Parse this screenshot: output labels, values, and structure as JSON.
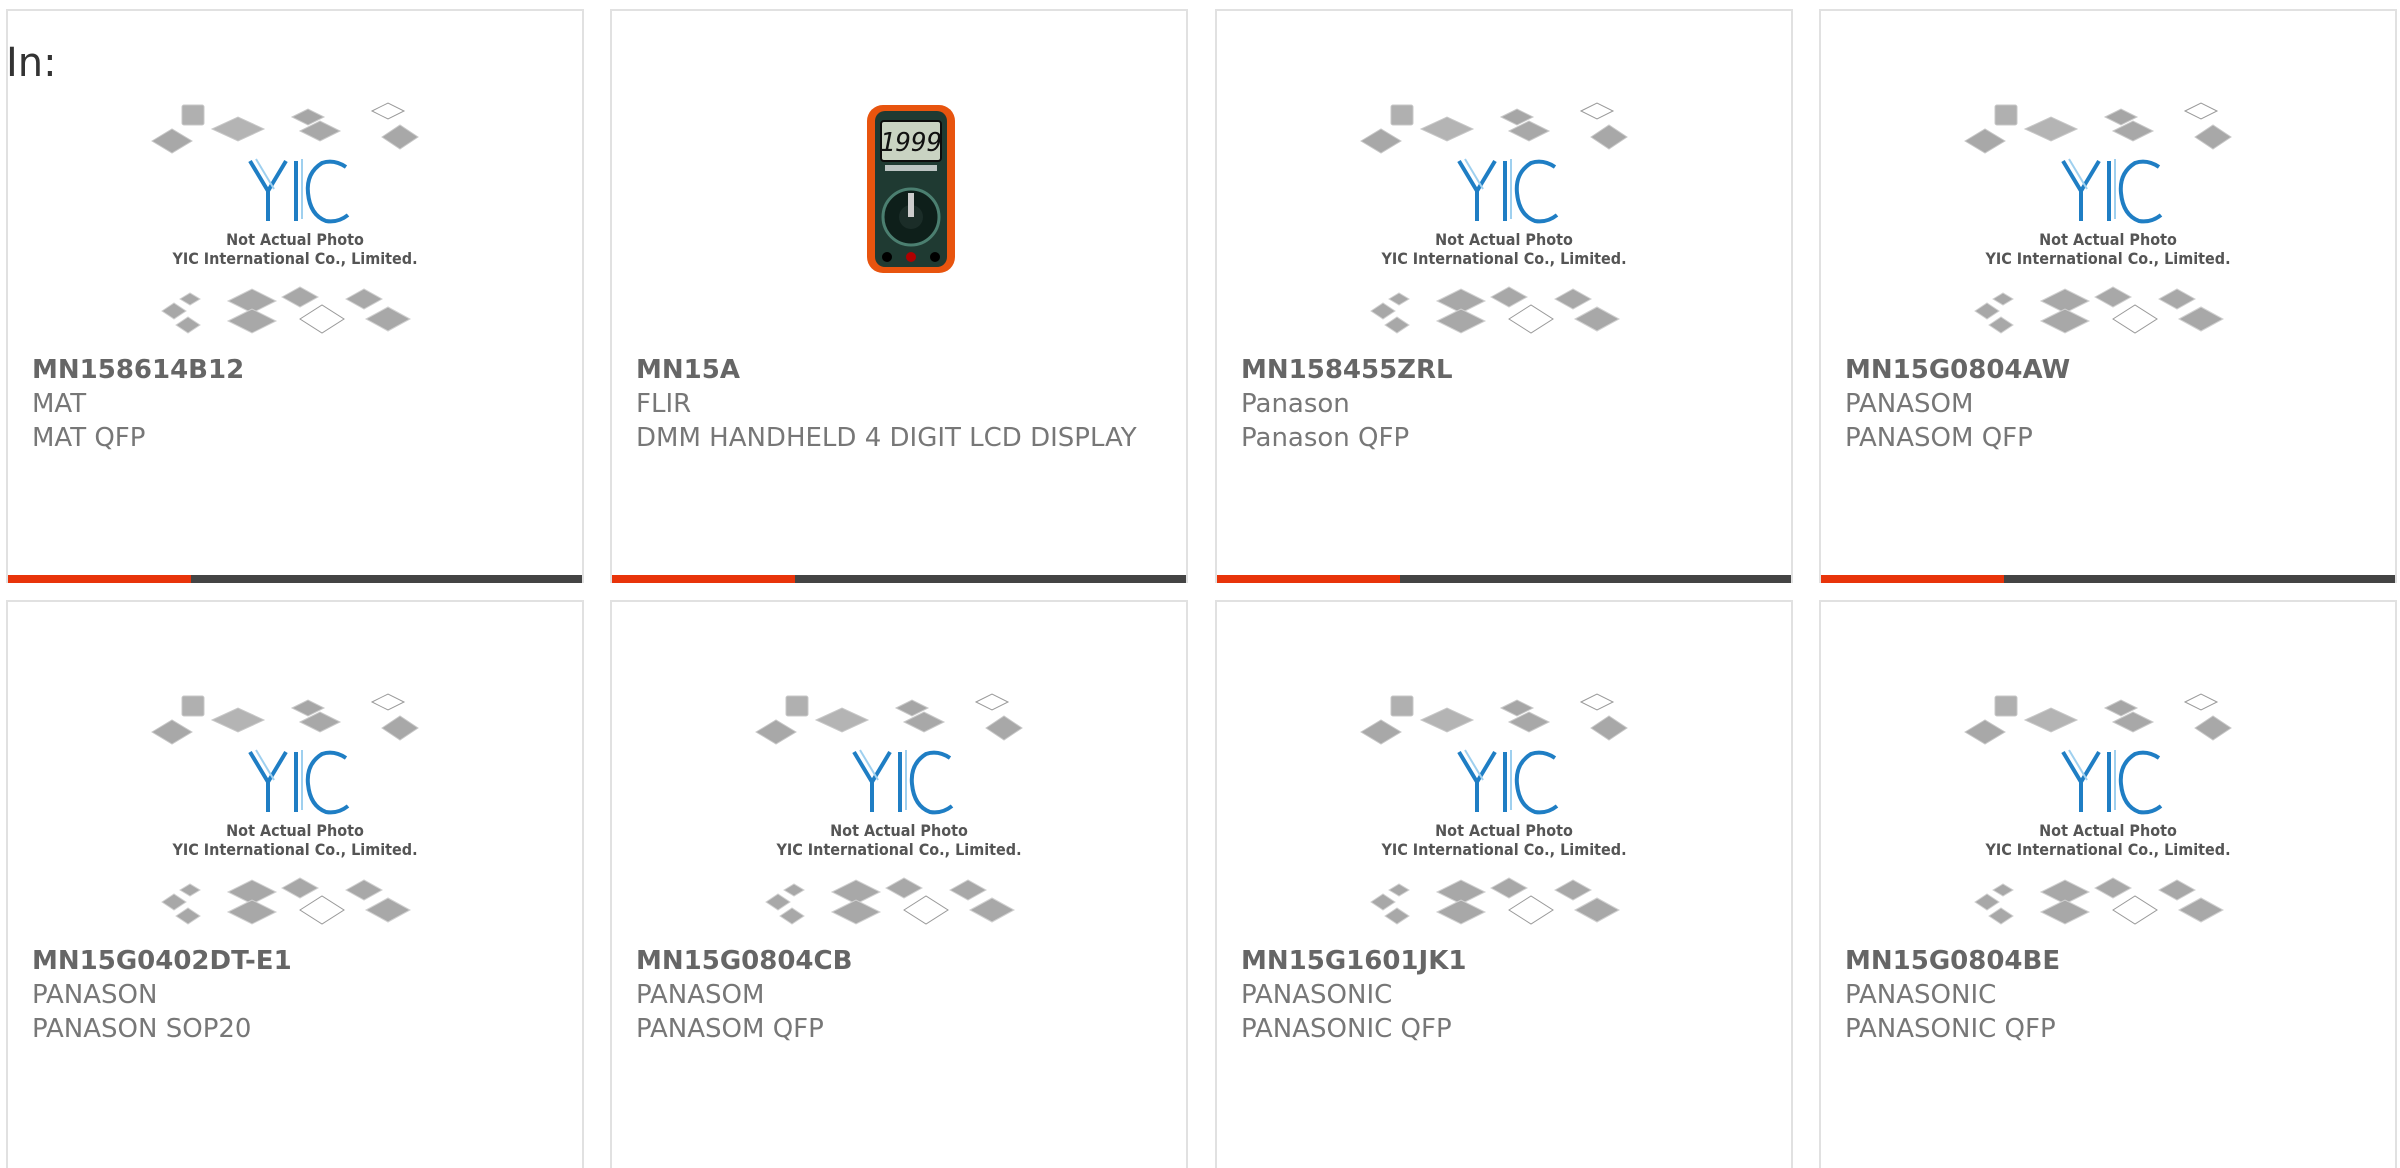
{
  "in_label": "In:",
  "placeholder": {
    "line1": "Not Actual Photo",
    "line2": "YIC International Co., Limited.",
    "logo_text": "YIC"
  },
  "colors": {
    "accent": "#e8340a",
    "bar": "#444444",
    "logo": "#1f7ec4"
  },
  "products": [
    {
      "part": "MN158614B12",
      "mfr": "MAT",
      "desc": "MAT QFP",
      "image": "placeholder-chip-photo"
    },
    {
      "part": "MN15A",
      "mfr": "FLIR",
      "desc": "DMM HANDHELD 4 DIGIT LCD DISPLAY",
      "image": "multimeter-photo",
      "display": "1999"
    },
    {
      "part": "MN158455ZRL",
      "mfr": "Panason",
      "desc": "Panason QFP",
      "image": "placeholder-chip-photo"
    },
    {
      "part": "MN15G0804AW",
      "mfr": "PANASOM",
      "desc": "PANASOM QFP",
      "image": "placeholder-chip-photo"
    },
    {
      "part": "MN15G0402DT-E1",
      "mfr": "PANASON",
      "desc": "PANASON SOP20",
      "image": "placeholder-chip-photo"
    },
    {
      "part": "MN15G0804CB",
      "mfr": "PANASOM",
      "desc": "PANASOM QFP",
      "image": "placeholder-chip-photo"
    },
    {
      "part": "MN15G1601JK1",
      "mfr": "PANASONIC",
      "desc": "PANASONIC QFP",
      "image": "placeholder-chip-photo"
    },
    {
      "part": "MN15G0804BE",
      "mfr": "PANASONIC",
      "desc": "PANASONIC QFP",
      "image": "placeholder-chip-photo"
    }
  ]
}
